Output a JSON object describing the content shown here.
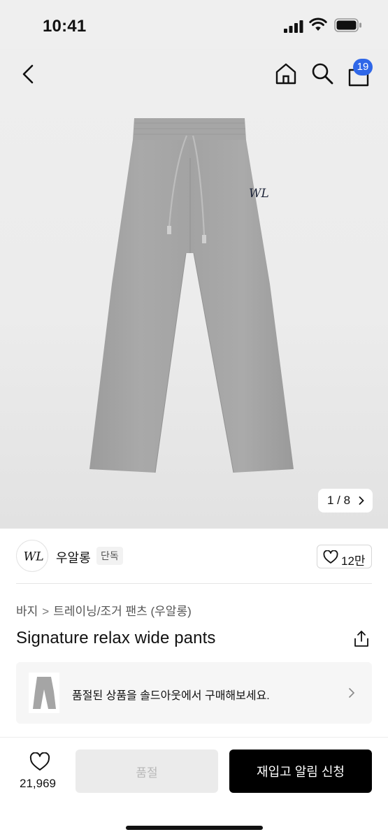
{
  "status_bar": {
    "time": "10:41"
  },
  "nav": {
    "cart_count": "19",
    "icons": [
      "back-icon",
      "home-icon",
      "search-icon",
      "cart-icon"
    ]
  },
  "gallery": {
    "pager": "1 / 8"
  },
  "brand": {
    "name": "우알롱",
    "tag": "단독",
    "likes": "12만"
  },
  "breadcrumb": {
    "items": [
      "바지",
      "트레이닝/조거 팬츠 (우알롱)"
    ]
  },
  "product": {
    "title": "Signature relax wide pants"
  },
  "soldout_banner": {
    "text": "품절된 상품을 솔드아웃에서 구매해보세요."
  },
  "bottom_bar": {
    "wish_count": "21,969",
    "soldout_label": "품절",
    "restock_label": "재입고 알림 신청"
  },
  "colors": {
    "accent_badge": "#2f67e8",
    "primary_button": "#000000",
    "disabled_button": "#ebebeb"
  }
}
